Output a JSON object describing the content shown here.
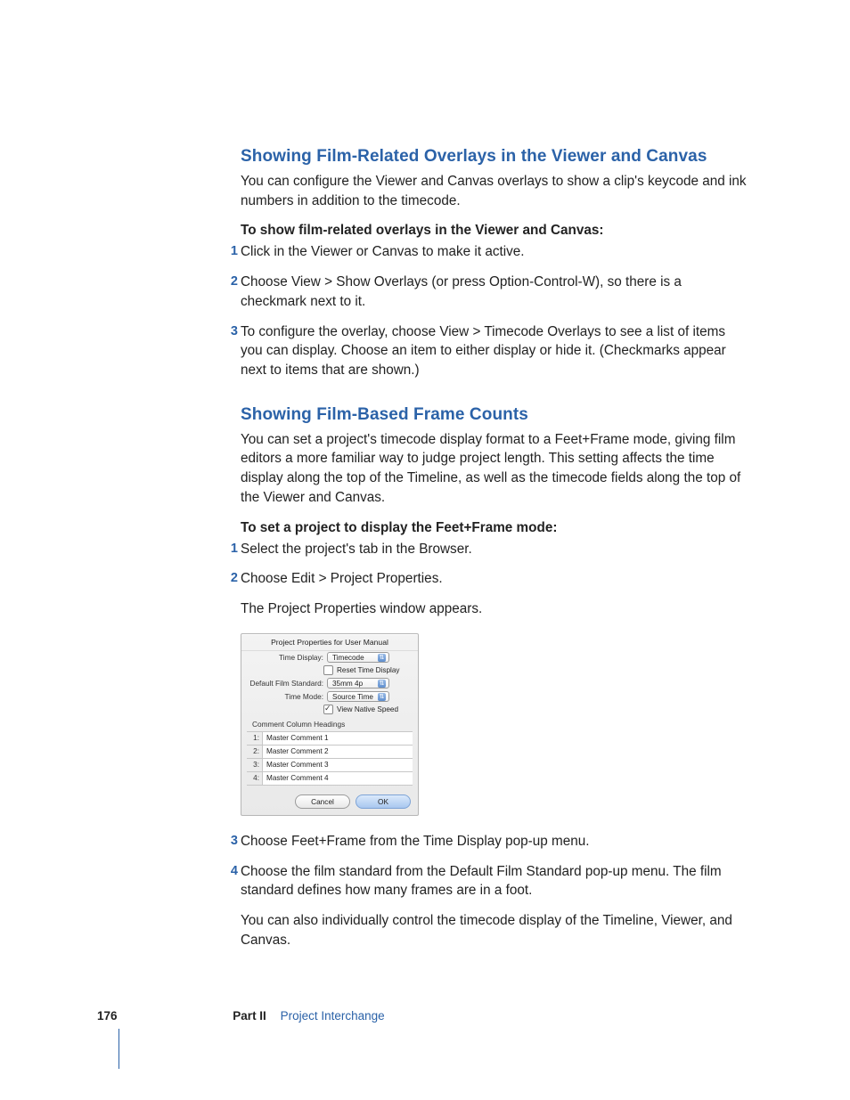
{
  "section1": {
    "heading": "Showing Film-Related Overlays in the Viewer and Canvas",
    "intro": "You can configure the Viewer and Canvas overlays to show a clip's keycode and ink numbers in addition to the timecode.",
    "procedure_title": "To show film-related overlays in the Viewer and Canvas:",
    "steps": [
      {
        "n": "1",
        "text": "Click in the Viewer or Canvas to make it active."
      },
      {
        "n": "2",
        "text": "Choose View > Show Overlays (or press Option-Control-W), so there is a checkmark next to it."
      },
      {
        "n": "3",
        "text": "To configure the overlay, choose View > Timecode Overlays to see a list of items you can display. Choose an item to either display or hide it. (Checkmarks appear next to items that are shown.)"
      }
    ]
  },
  "section2": {
    "heading": "Showing Film-Based Frame Counts",
    "intro": "You can set a project's timecode display format to a Feet+Frame mode, giving film editors a more familiar way to judge project length. This setting affects the time display along the top of the Timeline, as well as the timecode fields along the top of the Viewer and Canvas.",
    "procedure_title": "To set a project to display the Feet+Frame mode:",
    "steps_a": [
      {
        "n": "1",
        "text": "Select the project's tab in the Browser."
      },
      {
        "n": "2",
        "text": "Choose Edit > Project Properties."
      }
    ],
    "after_step2": "The Project Properties window appears.",
    "steps_b": [
      {
        "n": "3",
        "text": "Choose Feet+Frame from the Time Display pop-up menu."
      },
      {
        "n": "4",
        "text": "Choose the film standard from the Default Film Standard pop-up menu. The film standard defines how many frames are in a foot."
      }
    ],
    "tail": "You can also individually control the timecode display of the Timeline, Viewer, and Canvas."
  },
  "dialog": {
    "title": "Project Properties for User Manual",
    "time_display_label": "Time Display:",
    "time_display_value": "Timecode",
    "reset_label": "Reset Time Display",
    "film_std_label": "Default Film Standard:",
    "film_std_value": "35mm 4p",
    "time_mode_label": "Time Mode:",
    "time_mode_value": "Source Time",
    "native_speed_label": "View Native Speed",
    "comment_heading": "Comment Column Headings",
    "comments": [
      {
        "n": "1:",
        "v": "Master Comment 1"
      },
      {
        "n": "2:",
        "v": "Master Comment 2"
      },
      {
        "n": "3:",
        "v": "Master Comment 3"
      },
      {
        "n": "4:",
        "v": "Master Comment 4"
      }
    ],
    "cancel": "Cancel",
    "ok": "OK"
  },
  "footer": {
    "page": "176",
    "part": "Part II",
    "chapter": "Project Interchange"
  }
}
